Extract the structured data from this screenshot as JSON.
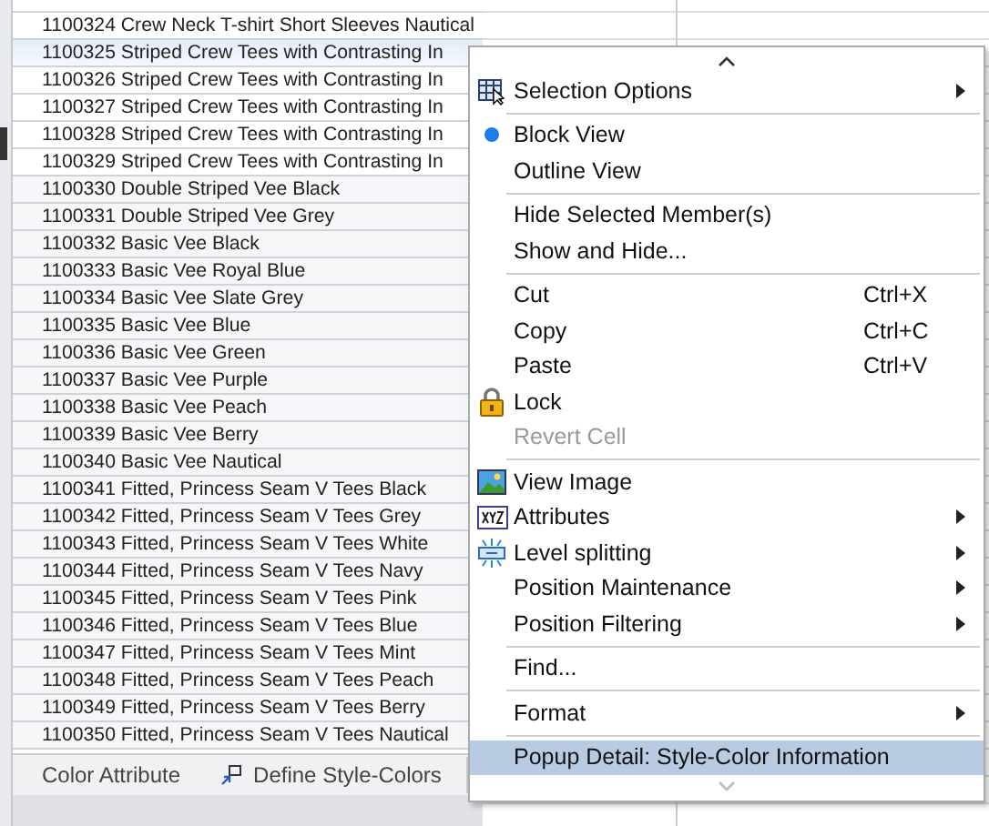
{
  "table": {
    "rows": [
      {
        "text": "1100324 Crew Neck T-shirt Short Sleeves Nautical",
        "selected": false
      },
      {
        "text": "1100325 Striped Crew Tees with Contrasting In",
        "selected": true
      },
      {
        "text": "1100326 Striped Crew Tees with Contrasting In",
        "selected": false
      },
      {
        "text": "1100327 Striped Crew Tees with Contrasting In",
        "selected": false
      },
      {
        "text": "1100328 Striped Crew Tees with Contrasting In",
        "selected": false
      },
      {
        "text": "1100329 Striped Crew Tees with Contrasting In",
        "selected": false
      },
      {
        "text": "1100330 Double Striped Vee Black",
        "selected": false
      },
      {
        "text": "1100331 Double Striped Vee Grey",
        "selected": false
      },
      {
        "text": "1100332 Basic Vee Black",
        "selected": false
      },
      {
        "text": "1100333 Basic Vee Royal Blue",
        "selected": false
      },
      {
        "text": "1100334 Basic Vee Slate Grey",
        "selected": false
      },
      {
        "text": "1100335 Basic Vee Blue",
        "selected": false
      },
      {
        "text": "1100336 Basic Vee Green",
        "selected": false
      },
      {
        "text": "1100337 Basic Vee Purple",
        "selected": false
      },
      {
        "text": "1100338 Basic Vee Peach",
        "selected": false
      },
      {
        "text": "1100339 Basic Vee Berry",
        "selected": false
      },
      {
        "text": "1100340 Basic Vee Nautical",
        "selected": false
      },
      {
        "text": "1100341 Fitted, Princess Seam V Tees Black",
        "selected": false
      },
      {
        "text": "1100342 Fitted, Princess Seam V Tees Grey",
        "selected": false
      },
      {
        "text": "1100343 Fitted, Princess Seam V Tees White",
        "selected": false
      },
      {
        "text": "1100344 Fitted, Princess Seam V Tees Navy",
        "selected": false
      },
      {
        "text": "1100345 Fitted, Princess Seam V Tees Pink",
        "selected": false
      },
      {
        "text": "1100346 Fitted, Princess Seam V Tees Blue",
        "selected": false
      },
      {
        "text": "1100347 Fitted, Princess Seam V Tees Mint",
        "selected": false
      },
      {
        "text": "1100348 Fitted, Princess Seam V Tees Peach",
        "selected": false
      },
      {
        "text": "1100349 Fitted, Princess Seam V Tees Berry",
        "selected": false
      },
      {
        "text": "1100350 Fitted, Princess Seam V Tees Nautical",
        "selected": false
      }
    ]
  },
  "bottom_tabs": [
    {
      "label": "Color Attribute",
      "icon": false
    },
    {
      "label": "Define Style-Colors",
      "icon": true
    }
  ],
  "menu": {
    "items": [
      {
        "kind": "item",
        "label": "Selection Options",
        "submenu": true
      },
      {
        "kind": "separator"
      },
      {
        "kind": "item",
        "label": "Block View",
        "radio": true
      },
      {
        "kind": "item",
        "label": "Outline View",
        "radio": false
      },
      {
        "kind": "separator"
      },
      {
        "kind": "item",
        "label": "Hide Selected Member(s)"
      },
      {
        "kind": "item",
        "label": "Show and Hide..."
      },
      {
        "kind": "separator"
      },
      {
        "kind": "item",
        "label": "Cut",
        "shortcut": "Ctrl+X"
      },
      {
        "kind": "item",
        "label": "Copy",
        "shortcut": "Ctrl+C"
      },
      {
        "kind": "item",
        "label": "Paste",
        "shortcut": "Ctrl+V"
      },
      {
        "kind": "item",
        "label": "Lock"
      },
      {
        "kind": "item",
        "label": "Revert Cell",
        "disabled": true
      },
      {
        "kind": "separator"
      },
      {
        "kind": "item",
        "label": "View Image"
      },
      {
        "kind": "item",
        "label": "Attributes",
        "submenu": true
      },
      {
        "kind": "item",
        "label": "Level splitting",
        "submenu": true
      },
      {
        "kind": "item",
        "label": "Position Maintenance",
        "submenu": true
      },
      {
        "kind": "item",
        "label": "Position Filtering",
        "submenu": true
      },
      {
        "kind": "separator"
      },
      {
        "kind": "item",
        "label": "Find..."
      },
      {
        "kind": "separator"
      },
      {
        "kind": "item",
        "label": "Format",
        "submenu": true
      },
      {
        "kind": "separator"
      },
      {
        "kind": "item",
        "label": "Popup Detail: Style-Color Information",
        "selected": true
      }
    ]
  }
}
